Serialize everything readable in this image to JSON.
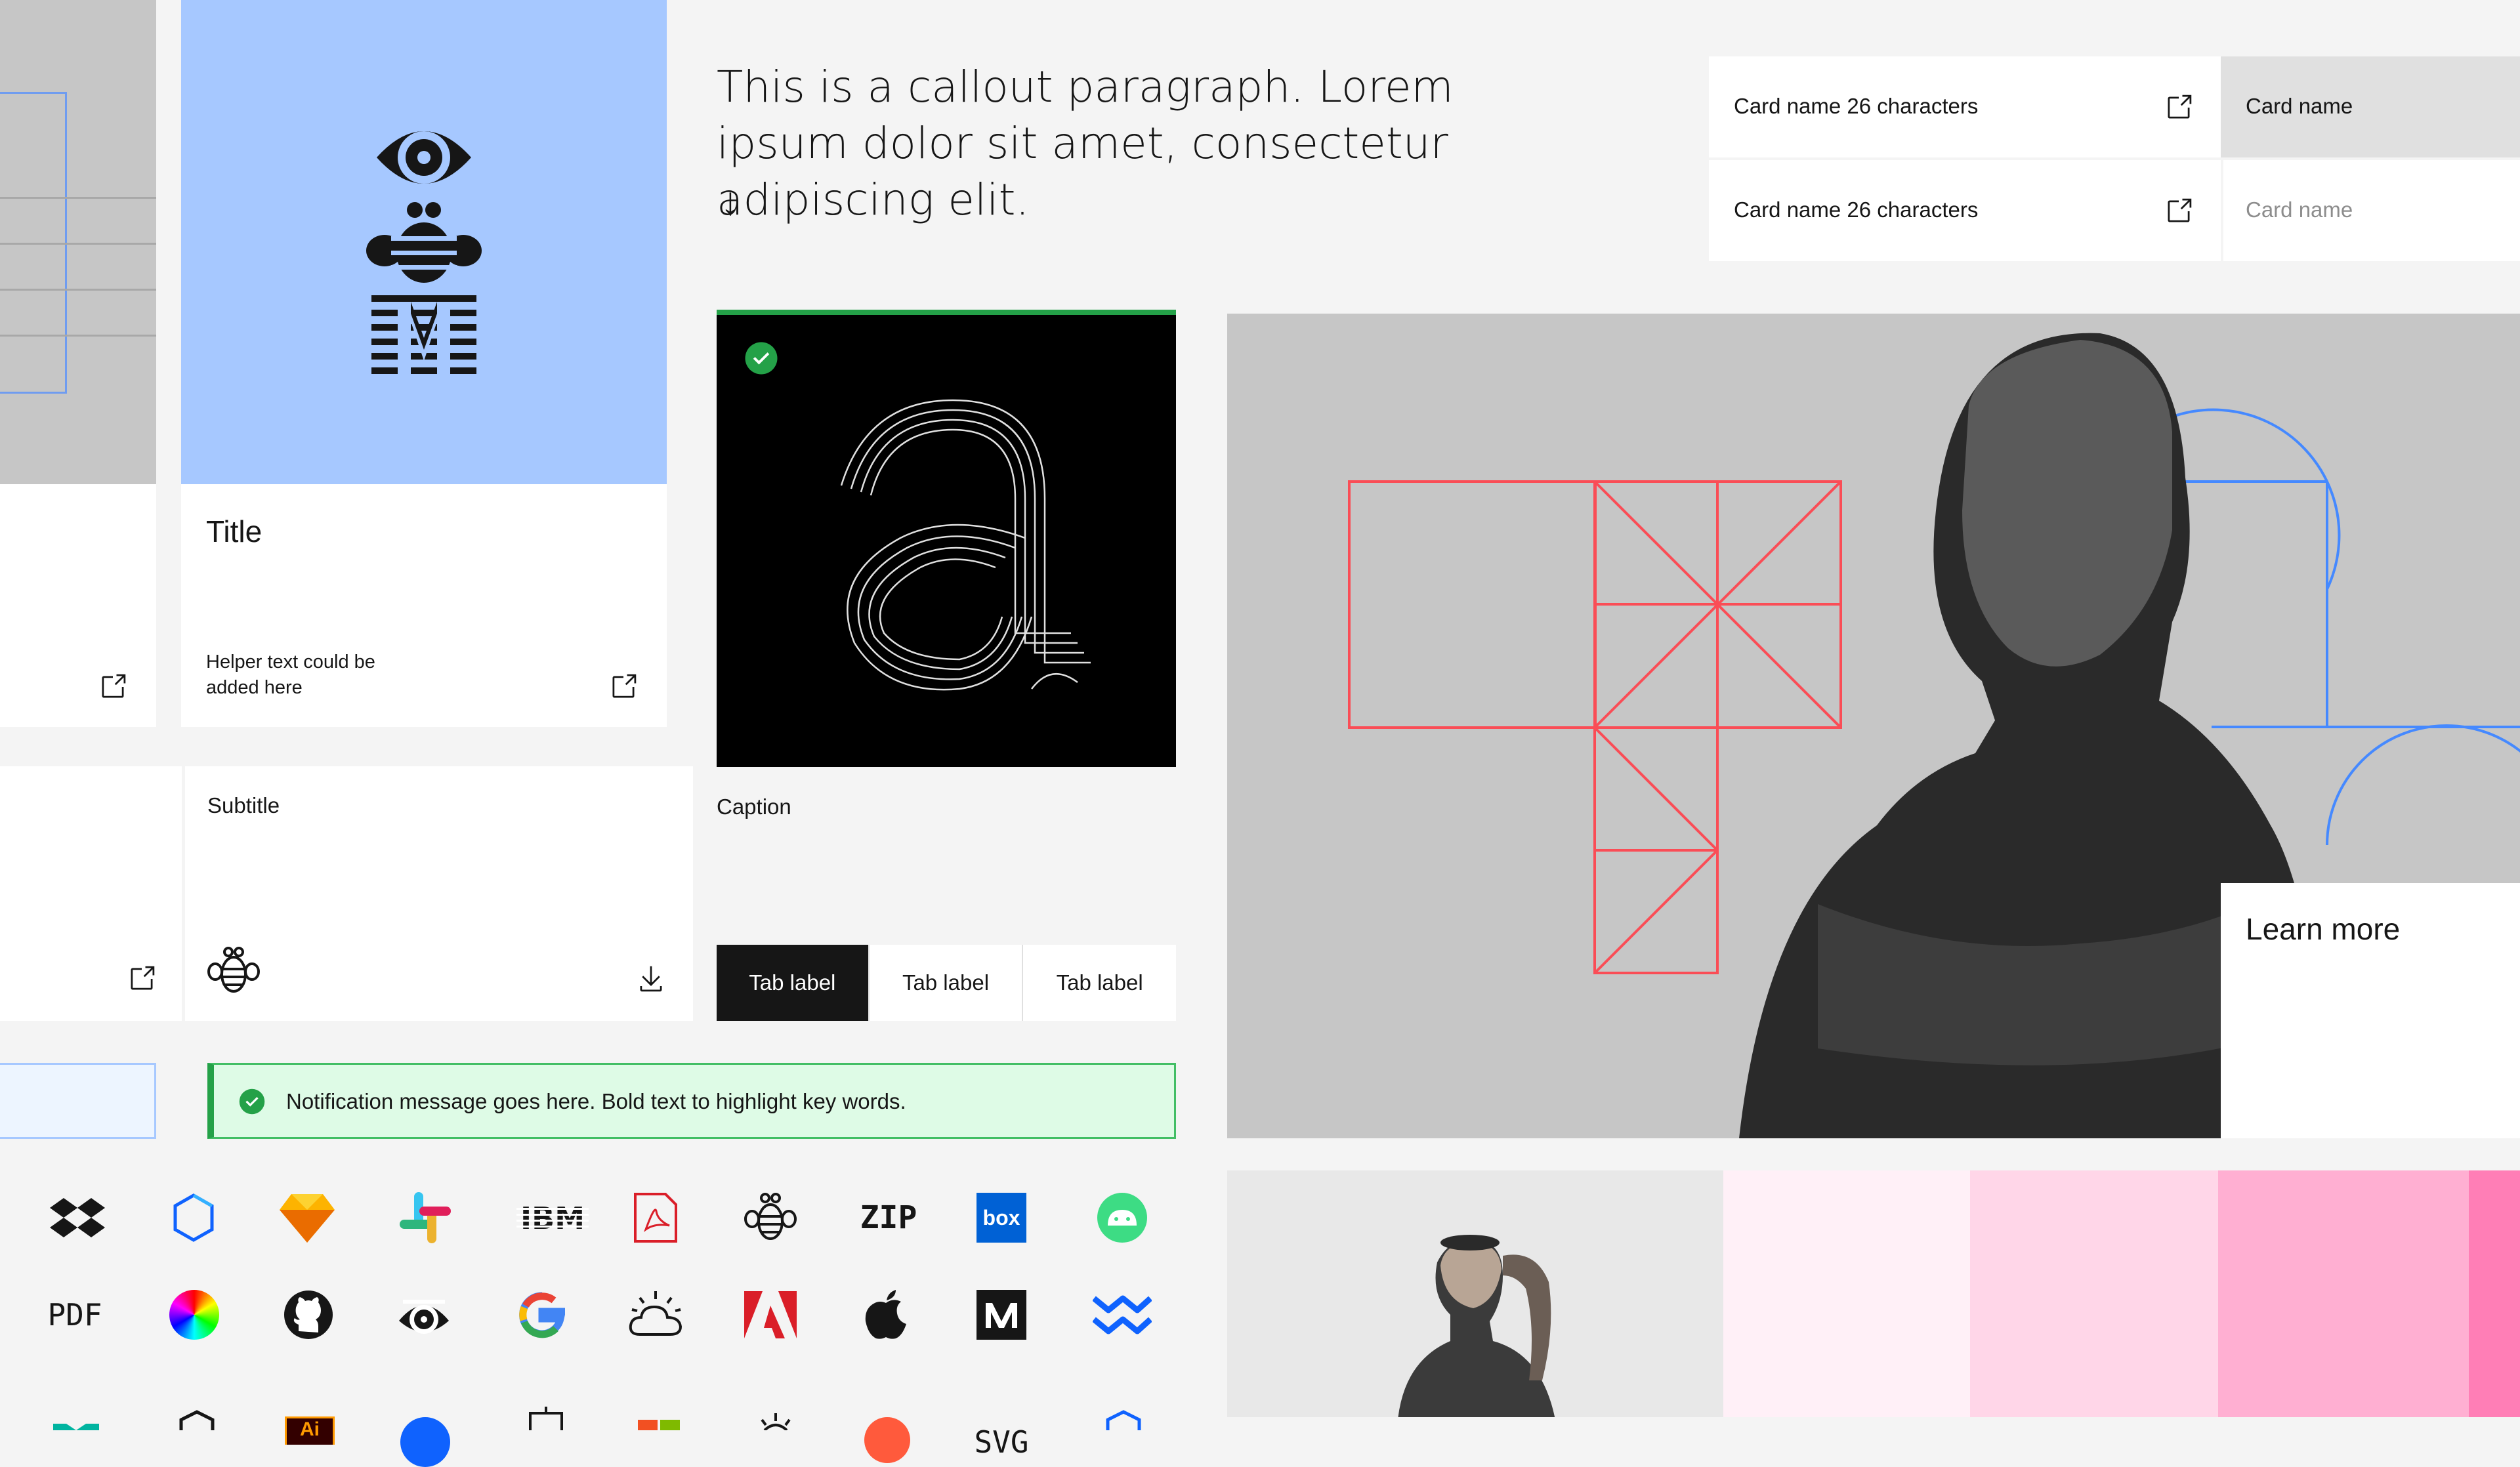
{
  "callout": {
    "text": "This is a callout paragraph. Lorem ipsum dolor sit amet, consectetur adipiscing elit.",
    "arrow": "↓"
  },
  "cards_list": [
    {
      "name": "Card name 26 characters",
      "icon": "launch-icon"
    },
    {
      "name": "Card name 26 characters",
      "icon": "launch-icon"
    }
  ],
  "card_name_tiles": [
    {
      "name": "Card name",
      "state": "selected"
    },
    {
      "name": "Card name",
      "state": "disabled"
    }
  ],
  "title_card": {
    "title": "Title",
    "helper_text": "Helper text could be added here",
    "image_bg": "#a6c8ff",
    "icon": "launch-icon"
  },
  "image_tile": {
    "caption": "Caption",
    "accent": "#24a148"
  },
  "subtitle_card": {
    "subtitle": "Subtitle",
    "icon": "bee-icon",
    "action_icon": "download-icon"
  },
  "tabs": [
    {
      "label": "Tab label",
      "selected": true
    },
    {
      "label": "Tab label",
      "selected": false
    },
    {
      "label": "Tab label",
      "selected": false
    }
  ],
  "notification": {
    "message": "Notification message goes here. Bold text to highlight key words.",
    "kind": "success",
    "color": "#24a148",
    "bg": "#defbe6"
  },
  "hero": {
    "cta": "Learn more"
  },
  "logos": [
    [
      "dropbox-logo",
      "ibm-cloud-pak-logo",
      "sketch-logo",
      "slack-logo",
      "ibm-logo",
      "pdf-acrobat-logo",
      "bee-icon",
      "zip-icon",
      "box-logo",
      "android-logo"
    ],
    [
      "pdf-icon",
      "color-palette-logo",
      "github-logo",
      "eye-icon",
      "google-logo",
      "cloud-weather-icon",
      "adobe-logo",
      "apple-logo",
      "medium-logo",
      "confluence-logo"
    ],
    [
      "partial-logo",
      "partial-logo",
      "partial-logo",
      "partial-logo",
      "partial-logo",
      "partial-logo",
      "partial-logo",
      "partial-logo",
      "partial-logo",
      "partial-logo"
    ]
  ],
  "logo_text": {
    "ibm": "IBM",
    "zip": "ZIP",
    "box": "box",
    "pdf": "PDF",
    "svg": "SVG",
    "ai": "Ai"
  },
  "swatches": [
    "#fff0f7",
    "#ffd6e8",
    "#ffafd2",
    "#ff7eb6"
  ]
}
